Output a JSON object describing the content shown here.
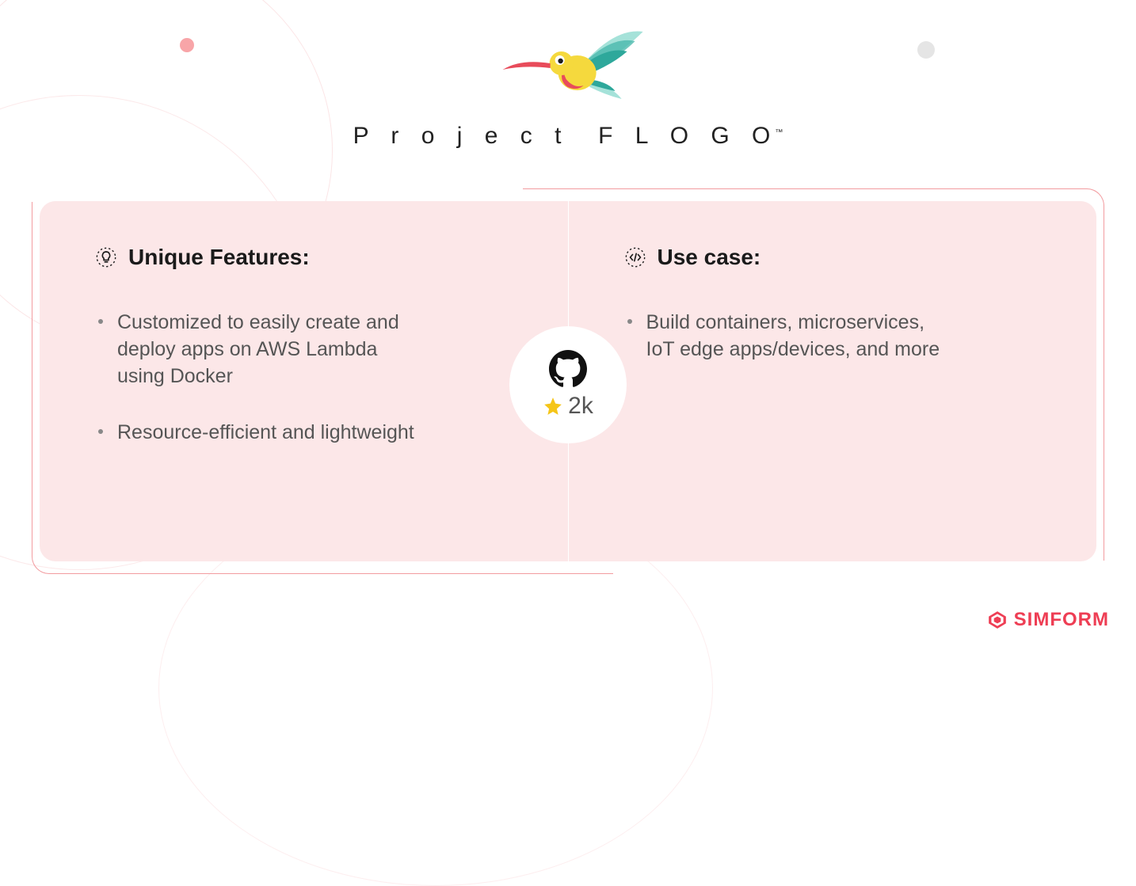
{
  "header": {
    "product_name": "Project FLOGO",
    "trademark": "™"
  },
  "features": {
    "title": "Unique Features:",
    "items": [
      "Customized to easily create and deploy apps on AWS Lambda using Docker",
      "Resource-efficient and lightweight"
    ]
  },
  "usecase": {
    "title": "Use case:",
    "items": [
      "Build containers, microservices, IoT edge apps/devices, and more"
    ]
  },
  "github": {
    "stars": "2k"
  },
  "brand": {
    "name": "SIMFORM"
  }
}
